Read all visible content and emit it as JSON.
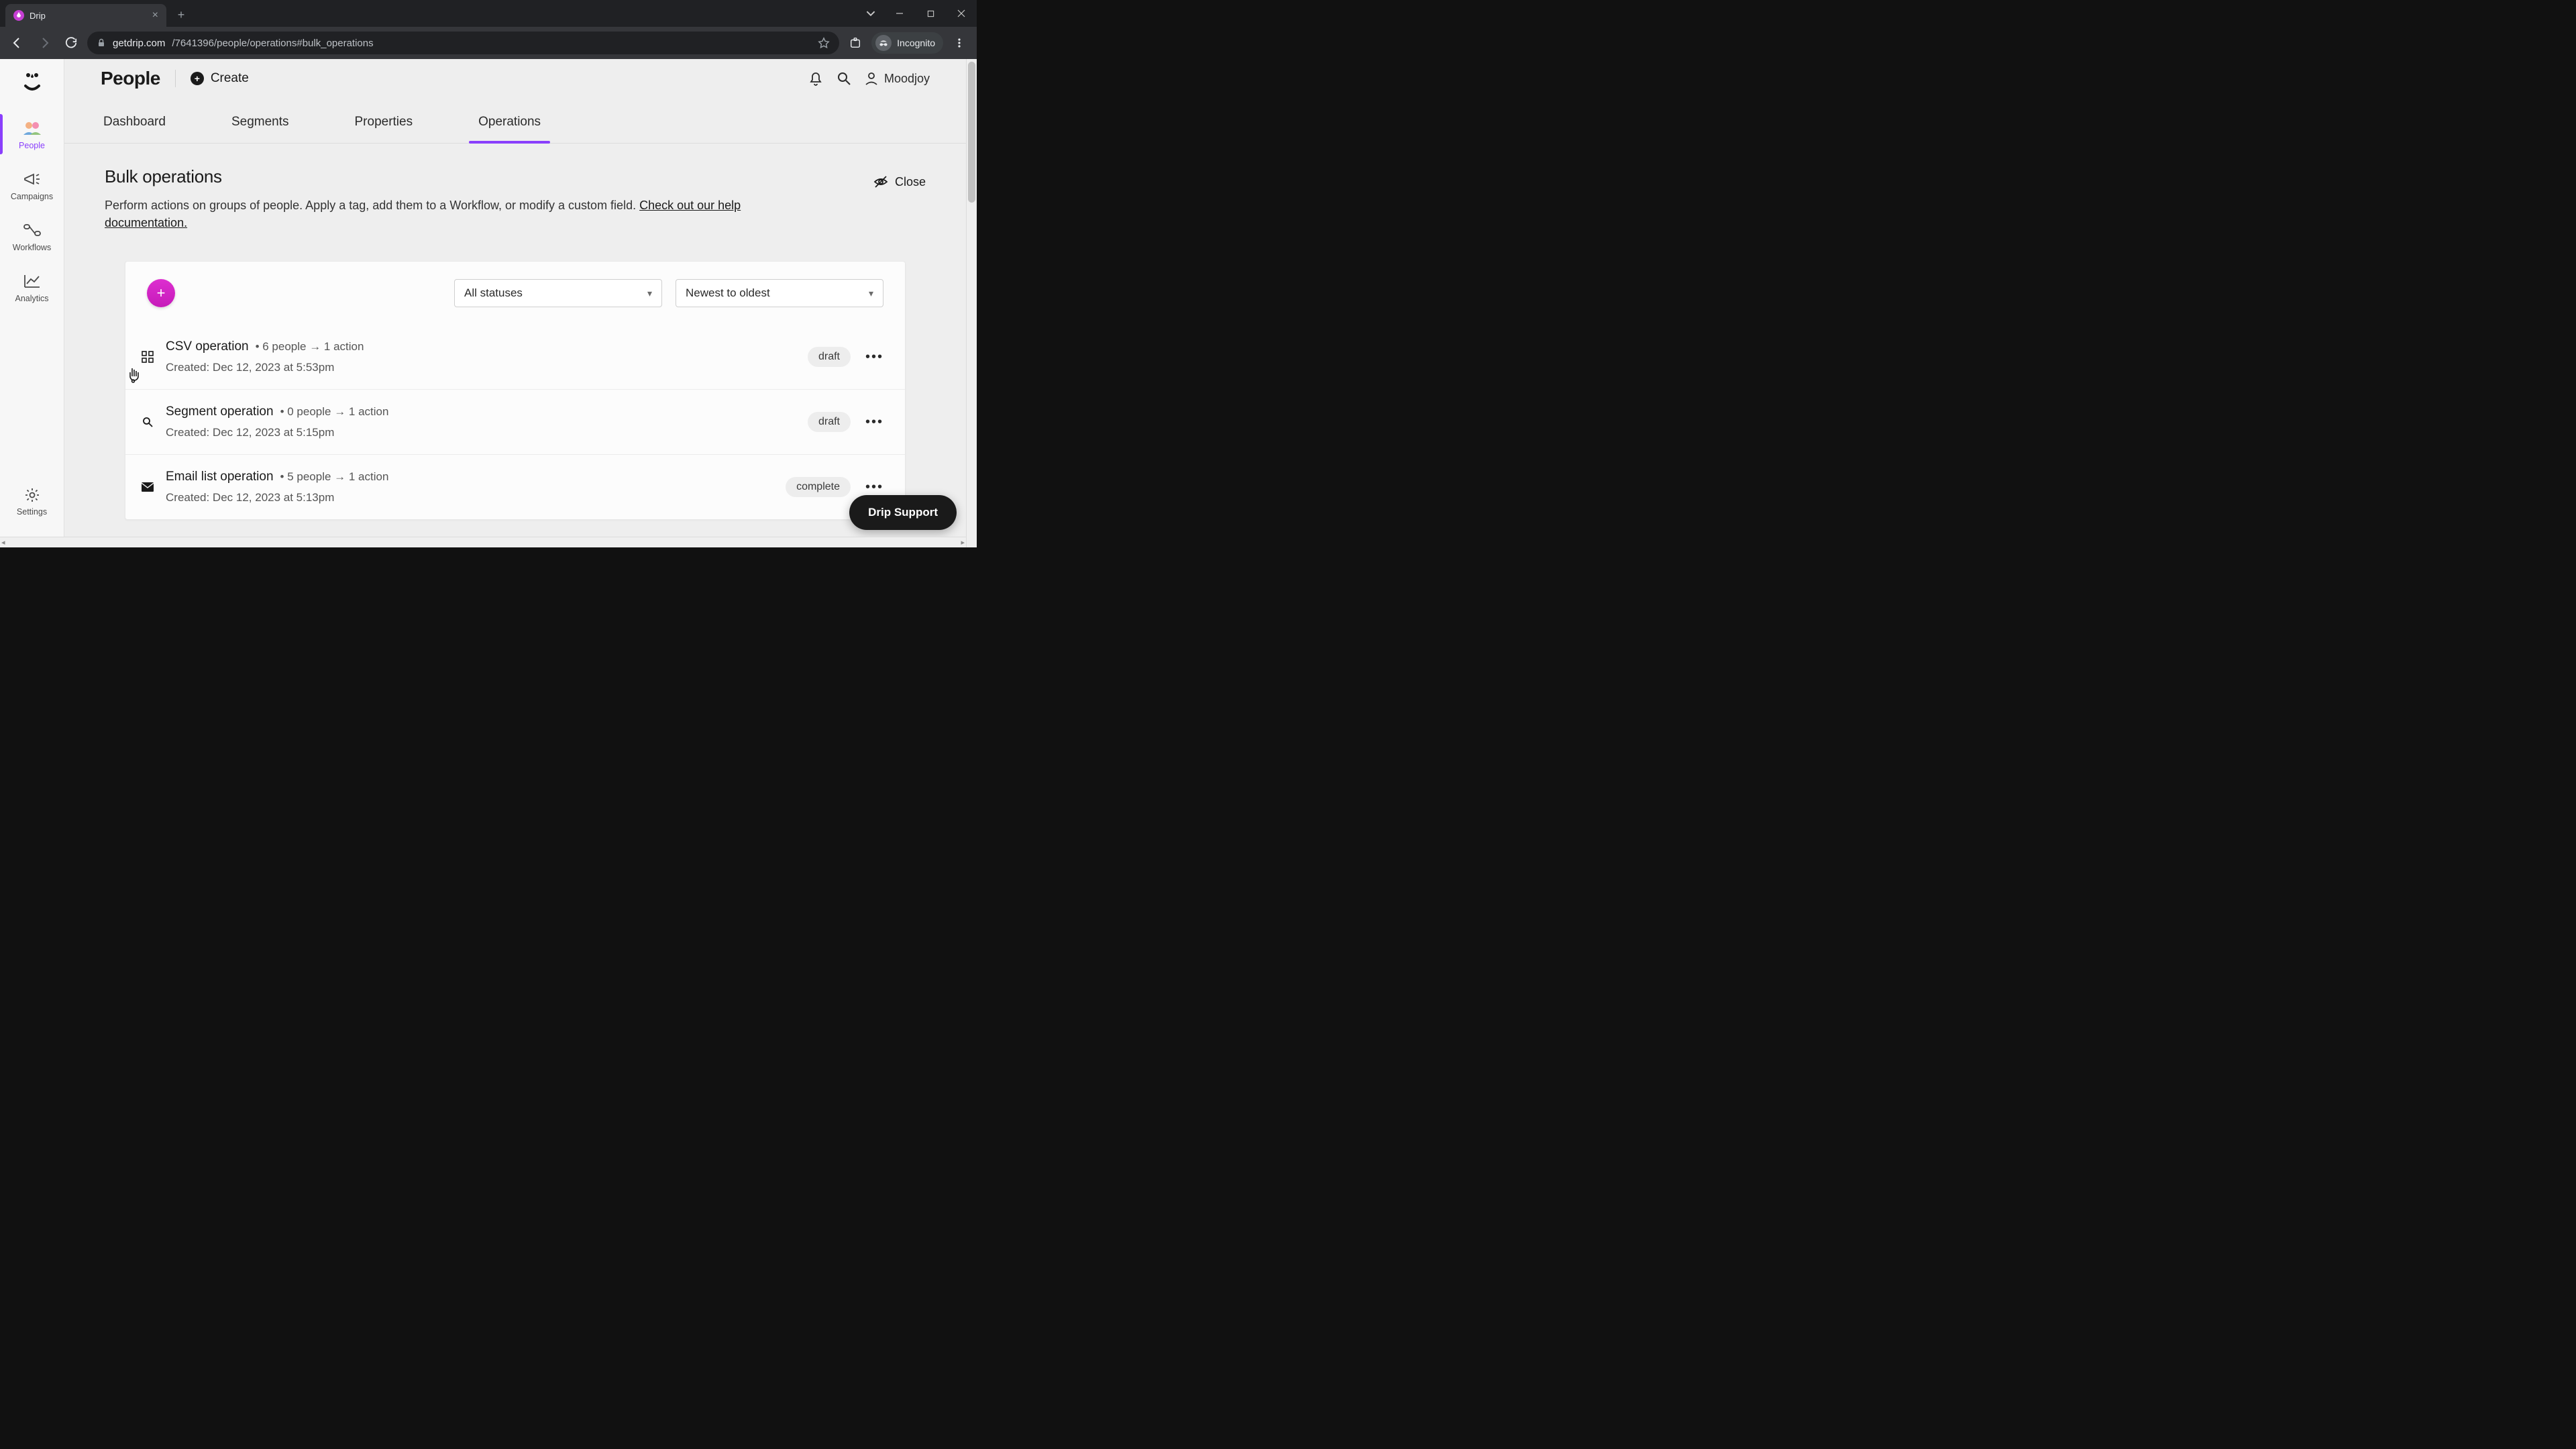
{
  "browser": {
    "tab_title": "Drip",
    "url_host": "getdrip.com",
    "url_path": "/7641396/people/operations#bulk_operations",
    "incognito_label": "Incognito"
  },
  "sidebar": {
    "items": [
      {
        "label": "People"
      },
      {
        "label": "Campaigns"
      },
      {
        "label": "Workflows"
      },
      {
        "label": "Analytics"
      }
    ],
    "settings_label": "Settings"
  },
  "header": {
    "title": "People",
    "create_label": "Create",
    "user_name": "Moodjoy"
  },
  "tabs": [
    {
      "label": "Dashboard"
    },
    {
      "label": "Segments"
    },
    {
      "label": "Properties"
    },
    {
      "label": "Operations"
    }
  ],
  "section": {
    "title": "Bulk operations",
    "desc_prefix": "Perform actions on groups of people. Apply a tag, add them to a Workflow, or modify a custom field. ",
    "help_link": "Check out our help documentation.",
    "close_label": "Close"
  },
  "filters": {
    "status": "All statuses",
    "sort": "Newest to oldest"
  },
  "operations": [
    {
      "name": "CSV operation",
      "meta": "• 6 people → 1 action",
      "created": "Created: Dec 12, 2023 at 5:53pm",
      "status": "draft"
    },
    {
      "name": "Segment operation",
      "meta": "• 0 people → 1 action",
      "created": "Created: Dec 12, 2023 at 5:15pm",
      "status": "draft"
    },
    {
      "name": "Email list operation",
      "meta": "• 5 people → 1 action",
      "created": "Created: Dec 12, 2023 at 5:13pm",
      "status": "complete"
    }
  ],
  "support_label": "Drip Support"
}
